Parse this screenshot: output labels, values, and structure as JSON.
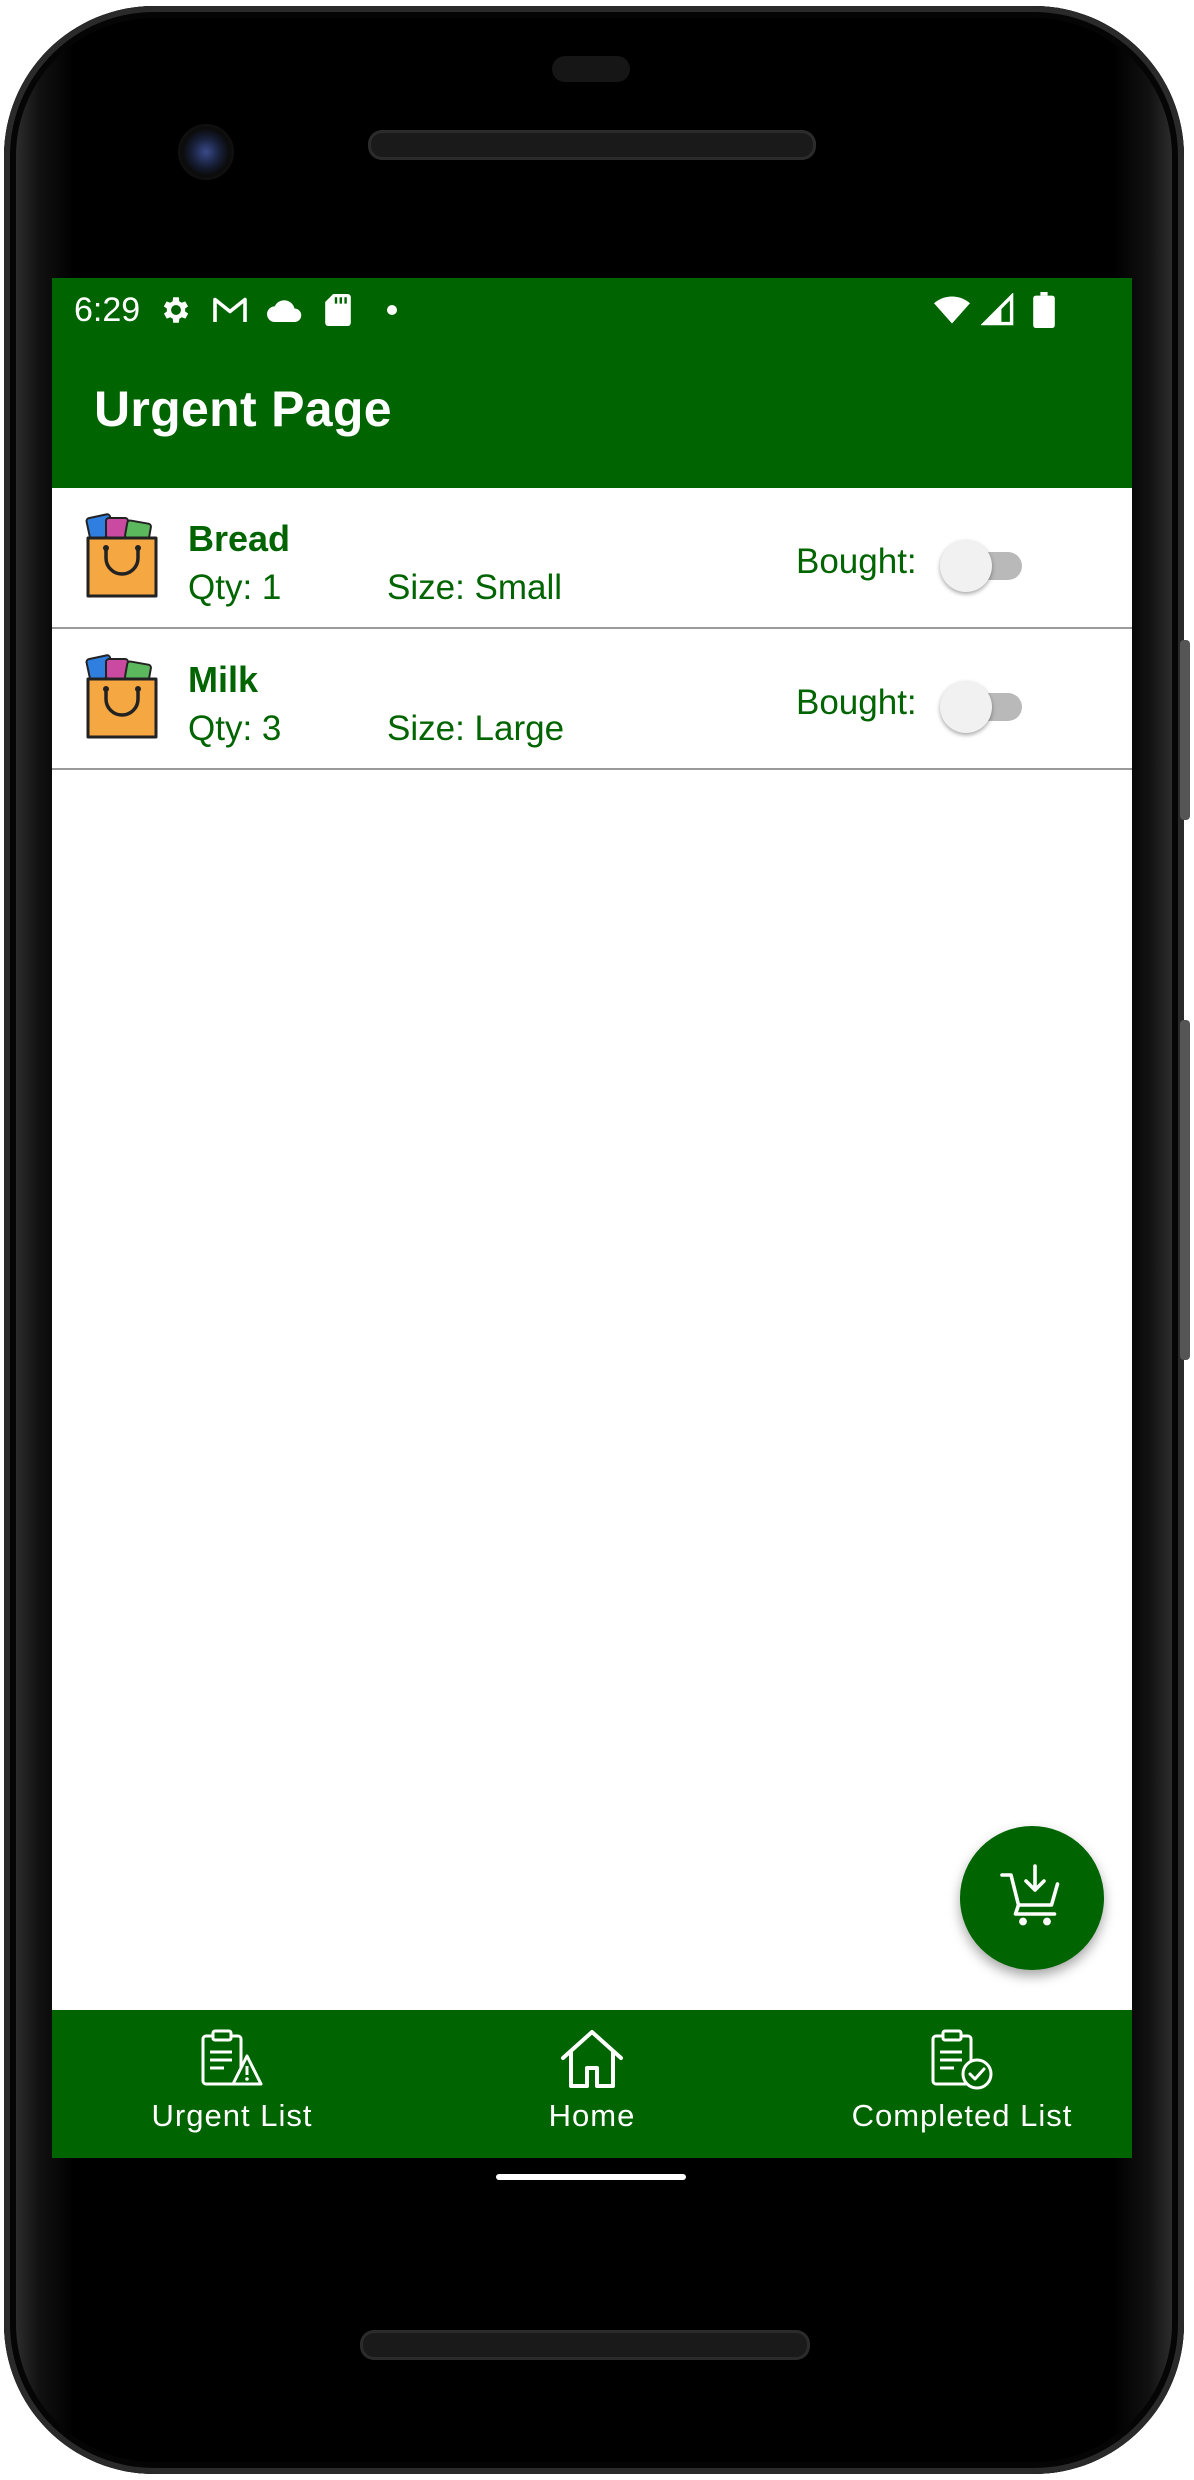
{
  "status_bar": {
    "time": "6:29",
    "left_icons": [
      "gear-icon",
      "gmail-icon",
      "cloud-icon",
      "sd-card-icon",
      "dot-icon"
    ],
    "right_icons": [
      "wifi-icon",
      "signal-icon",
      "battery-icon"
    ]
  },
  "app_bar": {
    "title": "Urgent Page"
  },
  "items": [
    {
      "name": "Bread",
      "qty": "Qty: 1",
      "size": "Size: Small",
      "bought_label": "Bought:",
      "bought": false
    },
    {
      "name": "Milk",
      "qty": "Qty: 3",
      "size": "Size: Large",
      "bought_label": "Bought:",
      "bought": false
    }
  ],
  "fab": {
    "icon": "cart-download-icon"
  },
  "bottom_nav": {
    "items": [
      {
        "label": "Urgent List",
        "icon": "clipboard-warning-icon"
      },
      {
        "label": "Home",
        "icon": "home-icon"
      },
      {
        "label": "Completed List",
        "icon": "clipboard-check-icon"
      }
    ]
  },
  "colors": {
    "primary": "#006400",
    "text_on_primary": "#ffffff",
    "switch_track_off": "#b9b9b9",
    "switch_thumb_off": "#f1f1f1"
  }
}
